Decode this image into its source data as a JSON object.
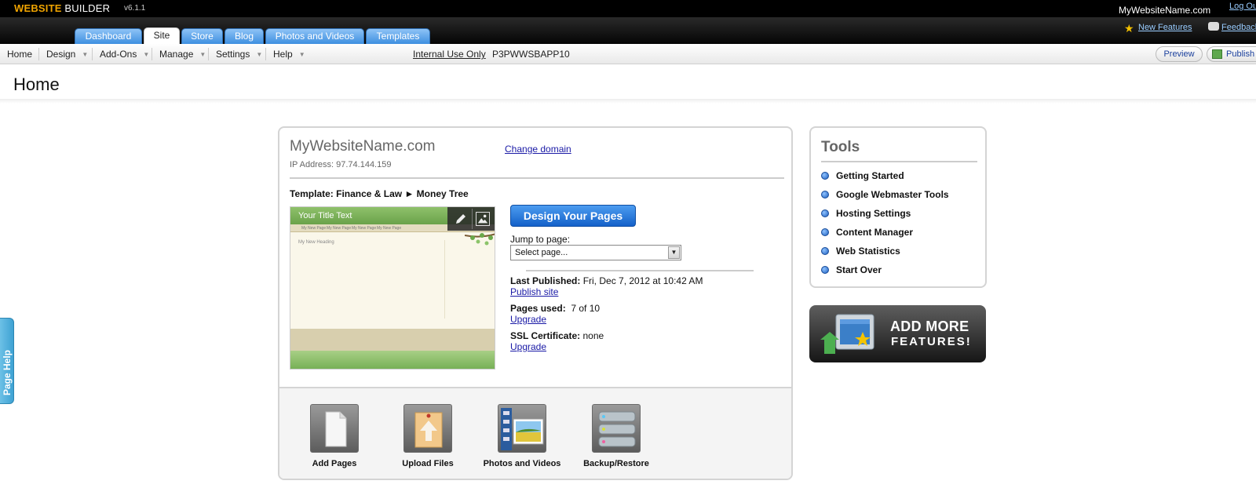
{
  "header": {
    "brand_bold": "WEBSITE",
    "brand_rest": " BUILDER",
    "version": "v6.1.1",
    "site_name": "MyWebsiteName.com",
    "logout": "Log Out",
    "new_features": "New Features",
    "feedback": "Feedback"
  },
  "tabs": [
    {
      "label": "Dashboard"
    },
    {
      "label": "Site"
    },
    {
      "label": "Store"
    },
    {
      "label": "Blog"
    },
    {
      "label": "Photos and Videos"
    },
    {
      "label": "Templates"
    }
  ],
  "menu": {
    "items": [
      {
        "label": "Home"
      },
      {
        "label": "Design"
      },
      {
        "label": "Add-Ons"
      },
      {
        "label": "Manage"
      },
      {
        "label": "Settings"
      },
      {
        "label": "Help"
      }
    ],
    "internal_label": "Internal Use Only",
    "server": "P3PWWSBAPP10",
    "preview": "Preview",
    "publish": "Publish"
  },
  "page": {
    "title": "Home",
    "page_help": "Page Help"
  },
  "site": {
    "domain": "MyWebsiteName.com",
    "change_domain": "Change domain",
    "ip_label": "IP Address:",
    "ip": "97.74.144.159",
    "template_line": "Template: Finance & Law ► Money Tree",
    "thumb_title": "Your Title Text",
    "thumb_heading": "My New Heading",
    "thumb_nav": [
      "My New Page",
      "My New Page",
      "My New Page",
      "My New Page"
    ],
    "design_button": "Design Your Pages",
    "jump_label": "Jump to page:",
    "jump_selected": "Select page...",
    "last_published_label": "Last Published:",
    "last_published": "Fri, Dec 7, 2012 at 10:42 AM",
    "publish_site": "Publish site",
    "pages_used_label": "Pages used:",
    "pages_used": "7 of 10",
    "upgrade": "Upgrade",
    "ssl_label": "SSL Certificate:",
    "ssl": "none"
  },
  "quick_actions": [
    {
      "label": "Add Pages",
      "icon": "page-icon"
    },
    {
      "label": "Upload Files",
      "icon": "upload-icon"
    },
    {
      "label": "Photos and Videos",
      "icon": "film-icon"
    },
    {
      "label": "Backup/Restore",
      "icon": "server-icon"
    }
  ],
  "tools": {
    "title": "Tools",
    "items": [
      {
        "label": "Getting Started"
      },
      {
        "label": "Google Webmaster Tools"
      },
      {
        "label": "Hosting Settings"
      },
      {
        "label": "Content Manager"
      },
      {
        "label": "Web Statistics"
      },
      {
        "label": "Start Over"
      }
    ]
  },
  "promo": {
    "line1": "ADD MORE",
    "line2": "FEATURES!"
  },
  "colors": {
    "tab_blue": "#3e8fe0",
    "brand_orange": "#f0a400",
    "button_blue": "#1461c9"
  }
}
